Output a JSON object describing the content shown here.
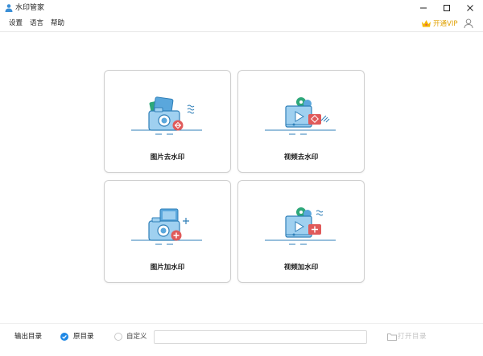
{
  "window": {
    "title": "水印管家",
    "controls": {
      "minimize": "—",
      "maximize": "☐",
      "close": "✕"
    }
  },
  "menu": {
    "items": [
      "设置",
      "语言",
      "帮助"
    ],
    "vip_label": "开通VIP",
    "vip_icon": "crown-icon",
    "user_icon": "user-icon"
  },
  "cards": [
    {
      "label": "图片去水印",
      "icon": "camera-remove-icon"
    },
    {
      "label": "视频去水印",
      "icon": "video-remove-icon"
    },
    {
      "label": "图片加水印",
      "icon": "camera-add-icon"
    },
    {
      "label": "视频加水印",
      "icon": "video-add-icon"
    }
  ],
  "bottom": {
    "output_label": "输出目录",
    "option_original": "原目录",
    "option_custom": "自定义",
    "selected": "原目录",
    "path_value": "",
    "open_label": "打开目录"
  },
  "colors": {
    "accent": "#1e88e5",
    "badge_red": "#e05a5a",
    "illus_blue": "#2f7fb8",
    "illus_green": "#2ea87a",
    "vip_gold": "#e0a000"
  }
}
